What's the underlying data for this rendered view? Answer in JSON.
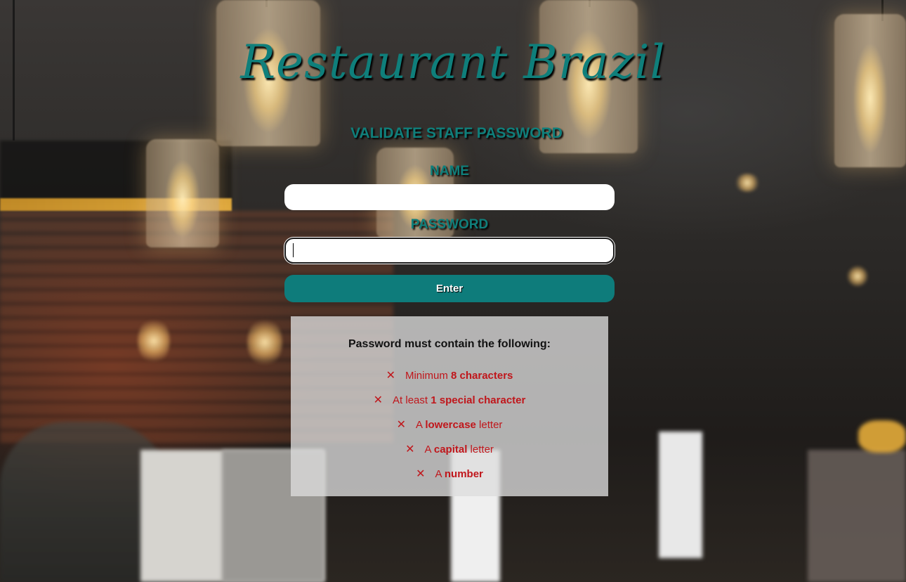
{
  "brand": {
    "title": "Restaurant Brazil"
  },
  "form": {
    "heading": "VALIDATE STAFF PASSWORD",
    "name_label": "NAME",
    "name_value": "",
    "password_label": "PASSWORD",
    "password_value": "",
    "enter_label": "Enter"
  },
  "requirements": {
    "title": "Password must contain the following:",
    "status_icon": "cross-icon",
    "items": [
      {
        "prefix": "Minimum ",
        "bold": "8 characters",
        "suffix": ""
      },
      {
        "prefix": "At least ",
        "bold": "1 special character",
        "suffix": ""
      },
      {
        "prefix": "A ",
        "bold": "lowercase",
        "suffix": " letter"
      },
      {
        "prefix": "A ",
        "bold": "capital",
        "suffix": " letter"
      },
      {
        "prefix": "A ",
        "bold": "number",
        "suffix": ""
      }
    ],
    "mark": "✕"
  },
  "colors": {
    "accent": "#0f7f7b",
    "invalid": "#c0161b"
  }
}
